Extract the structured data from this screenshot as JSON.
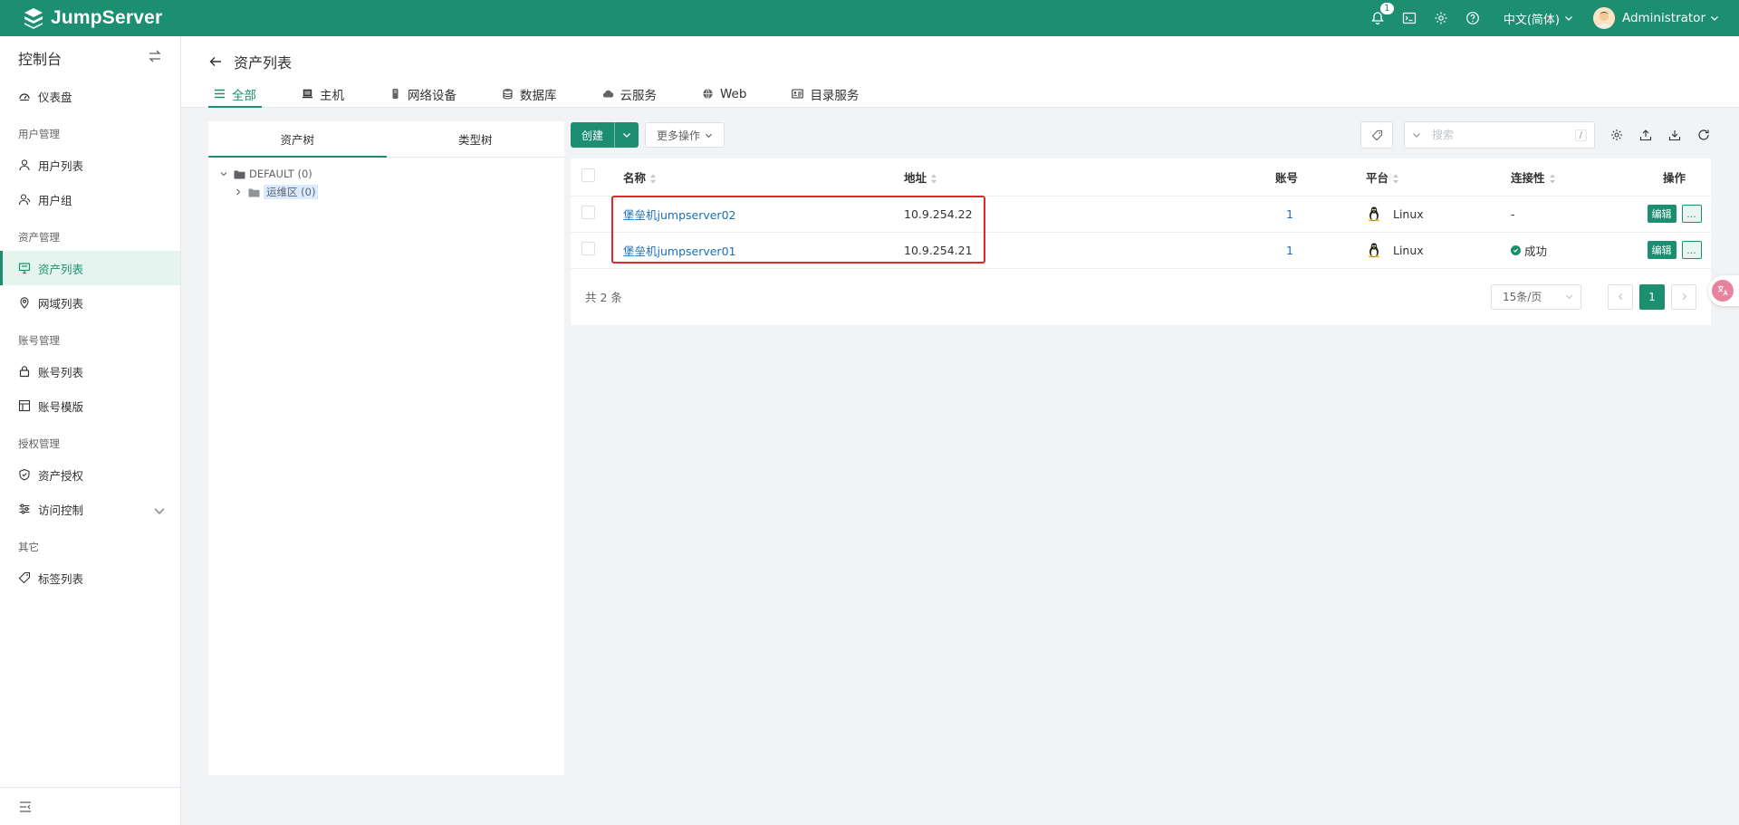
{
  "app": {
    "brand": "JumpServer",
    "accent_color": "#1c8f70"
  },
  "topbar": {
    "notification_count": "1",
    "language": "中文(简体)",
    "username": "Administrator",
    "icons": [
      "bell-icon",
      "terminal-icon",
      "gear-icon",
      "help-icon"
    ]
  },
  "sidebar": {
    "title": "控制台",
    "items": [
      {
        "type": "item",
        "label": "仪表盘",
        "icon": "dashboard-icon"
      },
      {
        "type": "group",
        "label": "用户管理"
      },
      {
        "type": "item",
        "label": "用户列表",
        "icon": "user-icon"
      },
      {
        "type": "item",
        "label": "用户组",
        "icon": "user-group-icon"
      },
      {
        "type": "group",
        "label": "资产管理"
      },
      {
        "type": "item",
        "label": "资产列表",
        "icon": "monitor-icon",
        "active": true
      },
      {
        "type": "item",
        "label": "网域列表",
        "icon": "location-icon"
      },
      {
        "type": "group",
        "label": "账号管理"
      },
      {
        "type": "item",
        "label": "账号列表",
        "icon": "lock-icon"
      },
      {
        "type": "item",
        "label": "账号模版",
        "icon": "template-icon"
      },
      {
        "type": "group",
        "label": "授权管理"
      },
      {
        "type": "item",
        "label": "资产授权",
        "icon": "shield-icon"
      },
      {
        "type": "item",
        "label": "访问控制",
        "icon": "filter-icon",
        "expandable": true
      },
      {
        "type": "group",
        "label": "其它"
      },
      {
        "type": "item",
        "label": "标签列表",
        "icon": "tag-icon"
      }
    ]
  },
  "page": {
    "title": "资产列表",
    "tabs": [
      {
        "label": "全部",
        "icon": "list-icon",
        "active": true
      },
      {
        "label": "主机",
        "icon": "host-icon"
      },
      {
        "label": "网络设备",
        "icon": "network-device-icon"
      },
      {
        "label": "数据库",
        "icon": "database-icon"
      },
      {
        "label": "云服务",
        "icon": "cloud-icon"
      },
      {
        "label": "Web",
        "icon": "globe-icon"
      },
      {
        "label": "目录服务",
        "icon": "directory-icon"
      }
    ]
  },
  "tree": {
    "tabs": [
      "资产树",
      "类型树"
    ],
    "root": {
      "label": "DEFAULT (0)"
    },
    "child": {
      "label": "运维区 (0)"
    }
  },
  "toolbar": {
    "create_label": "创建",
    "more_label": "更多操作",
    "search_placeholder": "搜索",
    "search_shortcut": "/"
  },
  "table": {
    "columns": {
      "name": "名称",
      "address": "地址",
      "accounts": "账号",
      "platform": "平台",
      "connectivity": "连接性",
      "actions": "操作"
    },
    "rows": [
      {
        "name": "堡垒机jumpserver02",
        "address": "10.9.254.22",
        "accounts": "1",
        "platform": "Linux",
        "connectivity": "-",
        "connectivity_ok": false
      },
      {
        "name": "堡垒机jumpserver01",
        "address": "10.9.254.21",
        "accounts": "1",
        "platform": "Linux",
        "connectivity": "成功",
        "connectivity_ok": true
      }
    ],
    "edit_label": "编辑",
    "more_label": "...",
    "total": "共 2 条",
    "page_size": "15条/页",
    "current_page": "1"
  }
}
